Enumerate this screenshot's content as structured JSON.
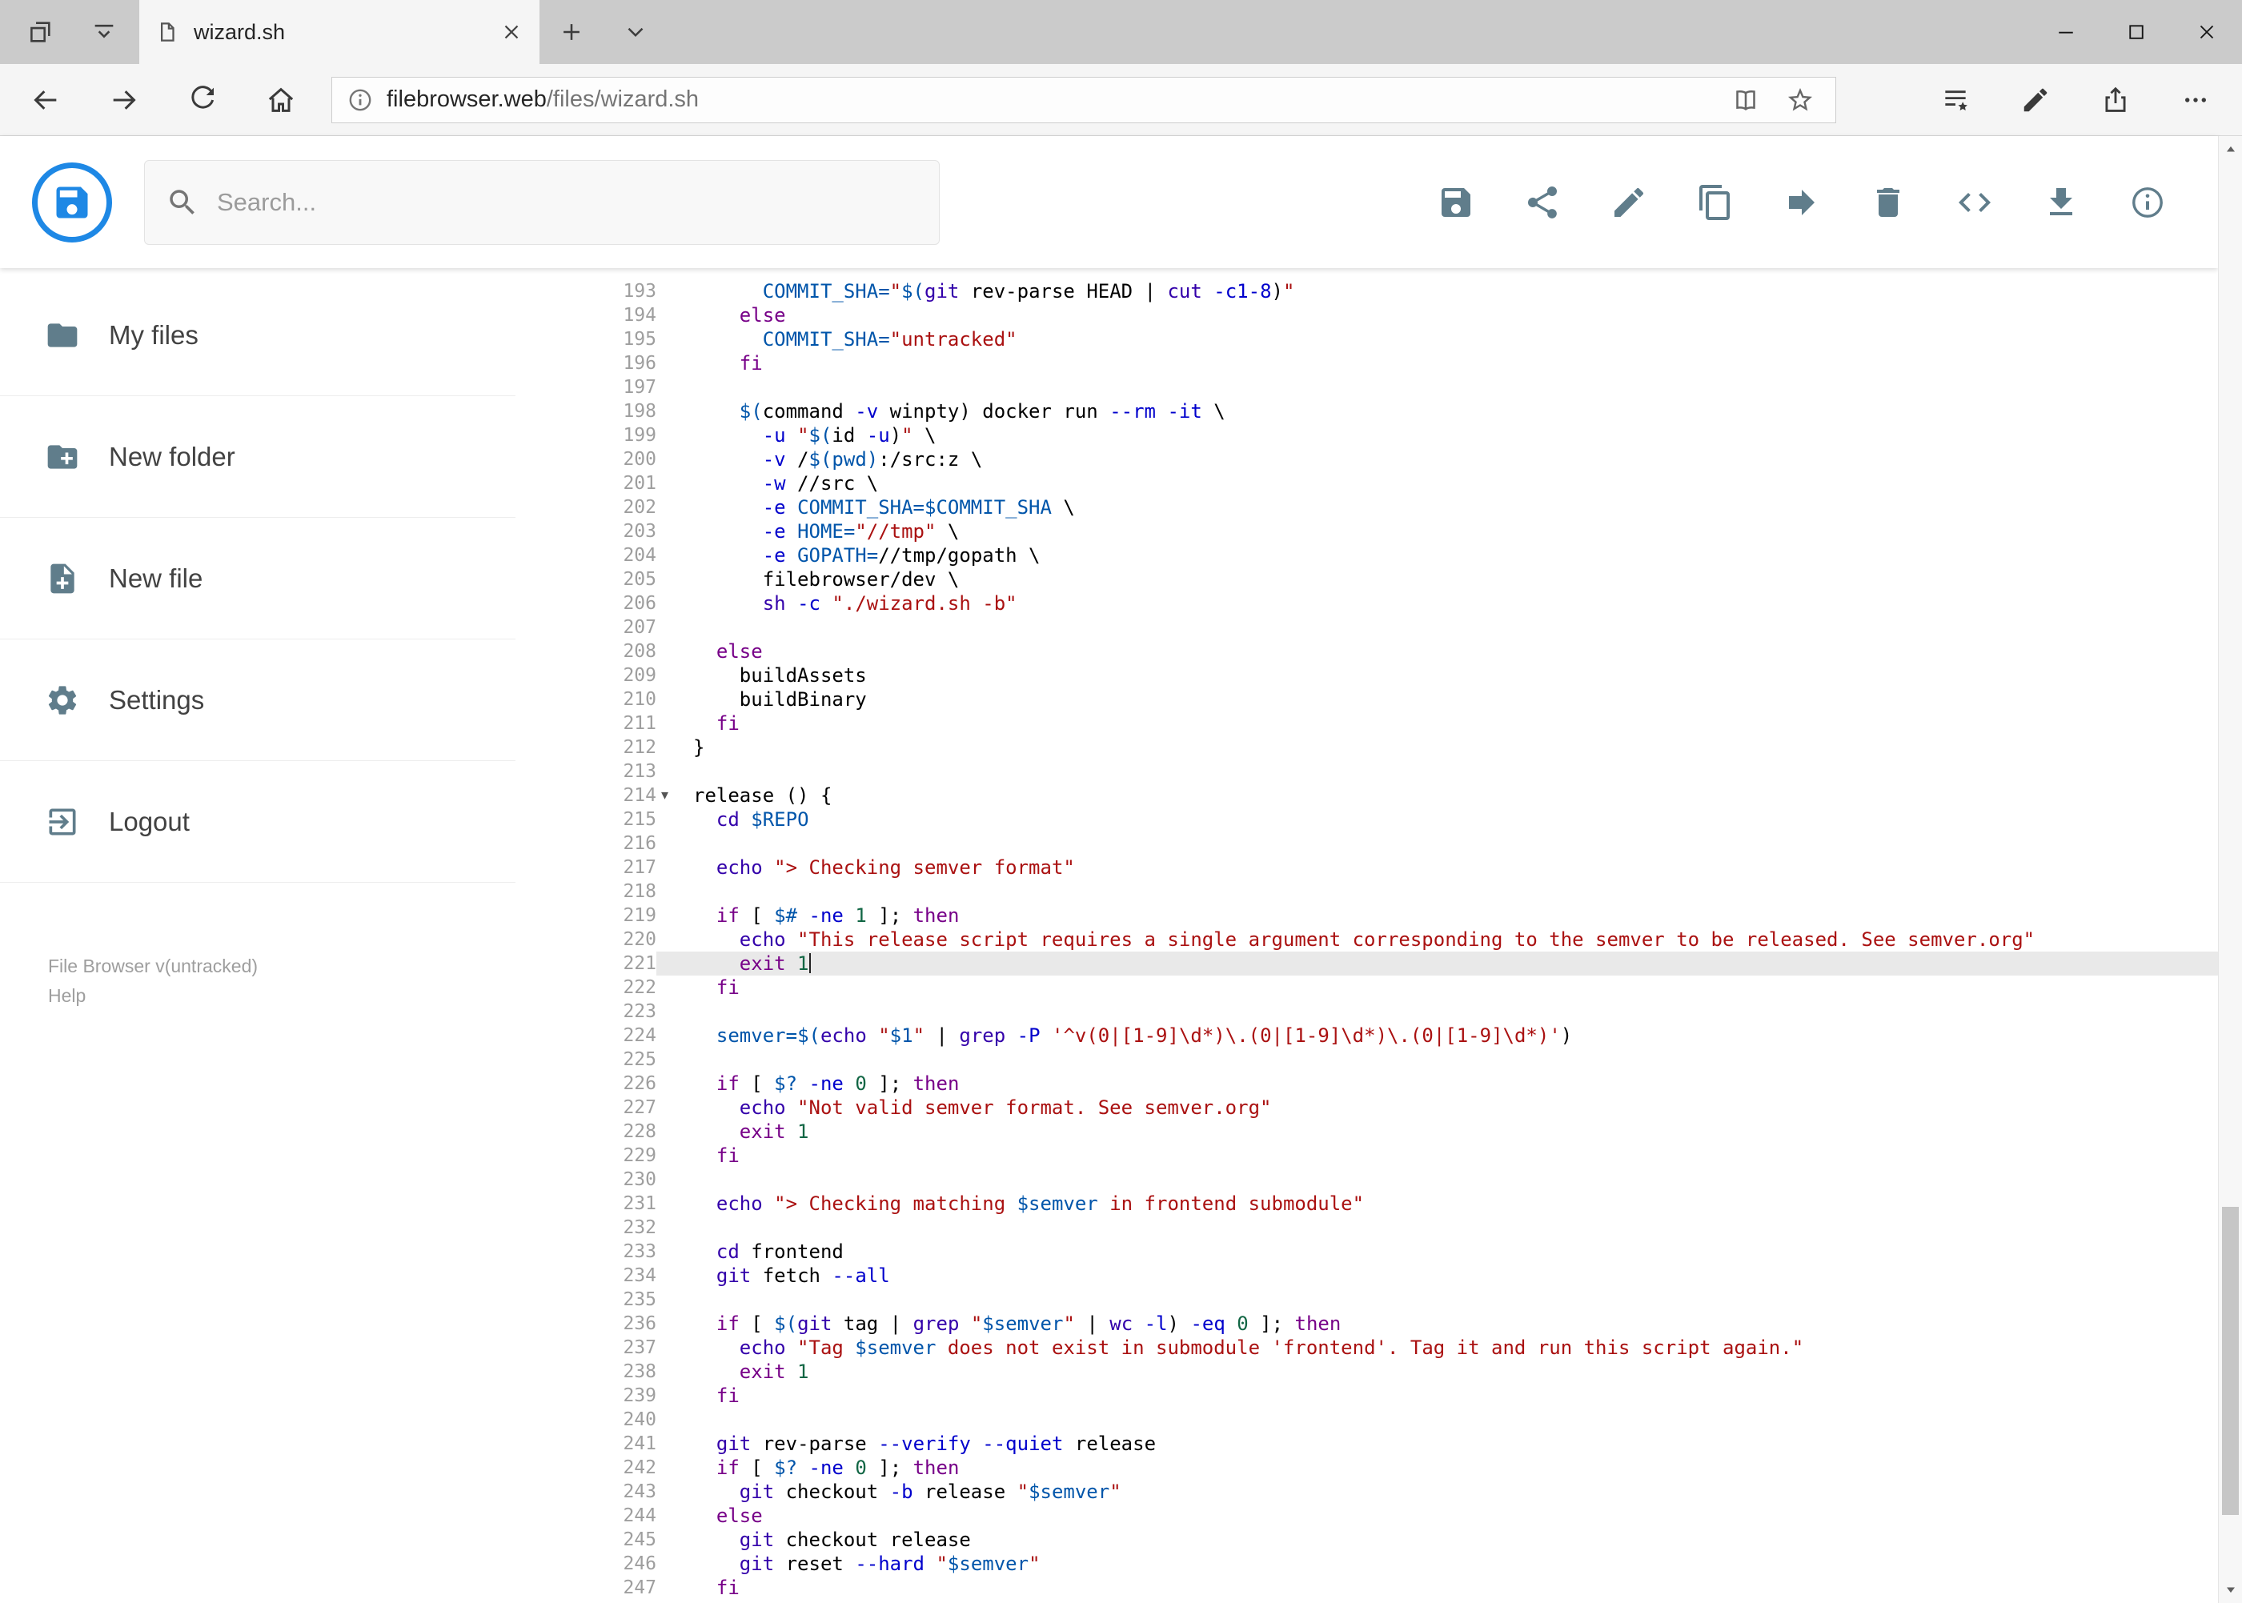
{
  "window": {
    "tab_title": "wizard.sh",
    "controls": [
      "minimize",
      "maximize",
      "close"
    ]
  },
  "address_bar": {
    "url_host": "filebrowser.web",
    "url_path": "/files/wizard.sh"
  },
  "app_header": {
    "search_placeholder": "Search...",
    "actions": [
      {
        "name": "save-button",
        "icon": "save"
      },
      {
        "name": "share-button",
        "icon": "share-nodes"
      },
      {
        "name": "rename-button",
        "icon": "edit"
      },
      {
        "name": "copy-button",
        "icon": "copy"
      },
      {
        "name": "move-button",
        "icon": "move-arrow"
      },
      {
        "name": "delete-button",
        "icon": "trash"
      },
      {
        "name": "code-view-button",
        "icon": "code"
      },
      {
        "name": "download-button",
        "icon": "download"
      },
      {
        "name": "info-button",
        "icon": "info"
      }
    ]
  },
  "sidebar": {
    "items": [
      {
        "name": "sidebar-item-my-files",
        "label": "My files",
        "icon": "folder"
      },
      {
        "name": "sidebar-item-new-folder",
        "label": "New folder",
        "icon": "new-folder"
      },
      {
        "name": "sidebar-item-new-file",
        "label": "New file",
        "icon": "new-file"
      },
      {
        "name": "sidebar-item-settings",
        "label": "Settings",
        "icon": "gear"
      },
      {
        "name": "sidebar-item-logout",
        "label": "Logout",
        "icon": "logout"
      }
    ],
    "footer": {
      "version": "File Browser v(untracked)",
      "help": "Help"
    }
  },
  "editor": {
    "language": "shell",
    "current_line": 221,
    "lines": [
      {
        "n": 193,
        "i": 6,
        "t": [
          [
            "v",
            "COMMIT_SHA="
          ],
          [
            "s",
            "\""
          ],
          [
            "v",
            "$("
          ],
          [
            "b",
            "git"
          ],
          [
            "p",
            " rev-parse HEAD | "
          ],
          [
            "b",
            "cut"
          ],
          [
            "p",
            " "
          ],
          [
            "a",
            "-c1-8"
          ],
          [
            "p",
            ")"
          ],
          [
            "s",
            "\""
          ]
        ]
      },
      {
        "n": 194,
        "i": 4,
        "t": [
          [
            "k",
            "else"
          ]
        ]
      },
      {
        "n": 195,
        "i": 6,
        "t": [
          [
            "v",
            "COMMIT_SHA="
          ],
          [
            "s",
            "\"untracked\""
          ]
        ]
      },
      {
        "n": 196,
        "i": 4,
        "t": [
          [
            "k",
            "fi"
          ]
        ]
      },
      {
        "n": 197,
        "i": 0,
        "t": []
      },
      {
        "n": 198,
        "i": 4,
        "t": [
          [
            "v",
            "$("
          ],
          [
            "p",
            "command "
          ],
          [
            "a",
            "-v"
          ],
          [
            "p",
            " winpty) docker run "
          ],
          [
            "a",
            "--rm"
          ],
          [
            "p",
            " "
          ],
          [
            "a",
            "-it"
          ],
          [
            "p",
            " \\"
          ]
        ]
      },
      {
        "n": 199,
        "i": 6,
        "t": [
          [
            "a",
            "-u"
          ],
          [
            "p",
            " "
          ],
          [
            "s",
            "\""
          ],
          [
            "v",
            "$("
          ],
          [
            "p",
            "id "
          ],
          [
            "a",
            "-u"
          ],
          [
            "p",
            ")"
          ],
          [
            "s",
            "\""
          ],
          [
            "p",
            " \\"
          ]
        ]
      },
      {
        "n": 200,
        "i": 6,
        "t": [
          [
            "a",
            "-v"
          ],
          [
            "p",
            " /"
          ],
          [
            "v",
            "$(pwd)"
          ],
          [
            "p",
            ":/src:z \\"
          ]
        ]
      },
      {
        "n": 201,
        "i": 6,
        "t": [
          [
            "a",
            "-w"
          ],
          [
            "p",
            " //src \\"
          ]
        ]
      },
      {
        "n": 202,
        "i": 6,
        "t": [
          [
            "a",
            "-e"
          ],
          [
            "p",
            " "
          ],
          [
            "v",
            "COMMIT_SHA=$COMMIT_SHA"
          ],
          [
            "p",
            " \\"
          ]
        ]
      },
      {
        "n": 203,
        "i": 6,
        "t": [
          [
            "a",
            "-e"
          ],
          [
            "p",
            " "
          ],
          [
            "v",
            "HOME="
          ],
          [
            "s",
            "\"//tmp\""
          ],
          [
            "p",
            " \\"
          ]
        ]
      },
      {
        "n": 204,
        "i": 6,
        "t": [
          [
            "a",
            "-e"
          ],
          [
            "p",
            " "
          ],
          [
            "v",
            "GOPATH="
          ],
          [
            "p",
            "//tmp/gopath \\"
          ]
        ]
      },
      {
        "n": 205,
        "i": 6,
        "t": [
          [
            "p",
            "filebrowser/dev \\"
          ]
        ]
      },
      {
        "n": 206,
        "i": 6,
        "t": [
          [
            "b",
            "sh"
          ],
          [
            "p",
            " "
          ],
          [
            "a",
            "-c"
          ],
          [
            "p",
            " "
          ],
          [
            "s",
            "\"./wizard.sh -b\""
          ]
        ]
      },
      {
        "n": 207,
        "i": 0,
        "t": []
      },
      {
        "n": 208,
        "i": 2,
        "t": [
          [
            "k",
            "else"
          ]
        ]
      },
      {
        "n": 209,
        "i": 4,
        "t": [
          [
            "p",
            "buildAssets"
          ]
        ]
      },
      {
        "n": 210,
        "i": 4,
        "t": [
          [
            "p",
            "buildBinary"
          ]
        ]
      },
      {
        "n": 211,
        "i": 2,
        "t": [
          [
            "k",
            "fi"
          ]
        ]
      },
      {
        "n": 212,
        "i": 0,
        "t": [
          [
            "p",
            "}"
          ]
        ]
      },
      {
        "n": 213,
        "i": 0,
        "t": []
      },
      {
        "n": 214,
        "i": 0,
        "fold": true,
        "t": [
          [
            "p",
            "release () {"
          ]
        ]
      },
      {
        "n": 215,
        "i": 2,
        "t": [
          [
            "b",
            "cd"
          ],
          [
            "p",
            " "
          ],
          [
            "v",
            "$REPO"
          ]
        ]
      },
      {
        "n": 216,
        "i": 0,
        "t": []
      },
      {
        "n": 217,
        "i": 2,
        "t": [
          [
            "b",
            "echo"
          ],
          [
            "p",
            " "
          ],
          [
            "s",
            "\"> Checking semver format\""
          ]
        ]
      },
      {
        "n": 218,
        "i": 0,
        "t": []
      },
      {
        "n": 219,
        "i": 2,
        "t": [
          [
            "k",
            "if"
          ],
          [
            "p",
            " [ "
          ],
          [
            "v",
            "$#"
          ],
          [
            "p",
            " "
          ],
          [
            "a",
            "-ne"
          ],
          [
            "p",
            " "
          ],
          [
            "n",
            "1"
          ],
          [
            "p",
            " ]; "
          ],
          [
            "k",
            "then"
          ]
        ]
      },
      {
        "n": 220,
        "i": 4,
        "t": [
          [
            "b",
            "echo"
          ],
          [
            "p",
            " "
          ],
          [
            "s",
            "\"This release script requires a single argument corresponding to the semver to be released. See semver.org\""
          ]
        ]
      },
      {
        "n": 221,
        "i": 4,
        "t": [
          [
            "k",
            "exit"
          ],
          [
            "p",
            " "
          ],
          [
            "n",
            "1"
          ]
        ]
      },
      {
        "n": 222,
        "i": 2,
        "t": [
          [
            "k",
            "fi"
          ]
        ]
      },
      {
        "n": 223,
        "i": 0,
        "t": []
      },
      {
        "n": 224,
        "i": 2,
        "t": [
          [
            "v",
            "semver="
          ],
          [
            "v",
            "$("
          ],
          [
            "b",
            "echo"
          ],
          [
            "p",
            " "
          ],
          [
            "s",
            "\""
          ],
          [
            "v",
            "$1"
          ],
          [
            "s",
            "\""
          ],
          [
            "p",
            " | "
          ],
          [
            "b",
            "grep"
          ],
          [
            "p",
            " "
          ],
          [
            "a",
            "-P"
          ],
          [
            "p",
            " "
          ],
          [
            "s",
            "'^v(0|[1-9]\\d*)\\.(0|[1-9]\\d*)\\.(0|[1-9]\\d*)'"
          ],
          [
            "p",
            ")"
          ]
        ]
      },
      {
        "n": 225,
        "i": 0,
        "t": []
      },
      {
        "n": 226,
        "i": 2,
        "t": [
          [
            "k",
            "if"
          ],
          [
            "p",
            " [ "
          ],
          [
            "v",
            "$?"
          ],
          [
            "p",
            " "
          ],
          [
            "a",
            "-ne"
          ],
          [
            "p",
            " "
          ],
          [
            "n",
            "0"
          ],
          [
            "p",
            " ]; "
          ],
          [
            "k",
            "then"
          ]
        ]
      },
      {
        "n": 227,
        "i": 4,
        "t": [
          [
            "b",
            "echo"
          ],
          [
            "p",
            " "
          ],
          [
            "s",
            "\"Not valid semver format. See semver.org\""
          ]
        ]
      },
      {
        "n": 228,
        "i": 4,
        "t": [
          [
            "k",
            "exit"
          ],
          [
            "p",
            " "
          ],
          [
            "n",
            "1"
          ]
        ]
      },
      {
        "n": 229,
        "i": 2,
        "t": [
          [
            "k",
            "fi"
          ]
        ]
      },
      {
        "n": 230,
        "i": 0,
        "t": []
      },
      {
        "n": 231,
        "i": 2,
        "t": [
          [
            "b",
            "echo"
          ],
          [
            "p",
            " "
          ],
          [
            "s",
            "\"> Checking matching "
          ],
          [
            "v",
            "$semver"
          ],
          [
            "s",
            " in frontend submodule\""
          ]
        ]
      },
      {
        "n": 232,
        "i": 0,
        "t": []
      },
      {
        "n": 233,
        "i": 2,
        "t": [
          [
            "b",
            "cd"
          ],
          [
            "p",
            " frontend"
          ]
        ]
      },
      {
        "n": 234,
        "i": 2,
        "t": [
          [
            "b",
            "git"
          ],
          [
            "p",
            " fetch "
          ],
          [
            "a",
            "--all"
          ]
        ]
      },
      {
        "n": 235,
        "i": 0,
        "t": []
      },
      {
        "n": 236,
        "i": 2,
        "t": [
          [
            "k",
            "if"
          ],
          [
            "p",
            " [ "
          ],
          [
            "v",
            "$("
          ],
          [
            "b",
            "git"
          ],
          [
            "p",
            " tag | "
          ],
          [
            "b",
            "grep"
          ],
          [
            "p",
            " "
          ],
          [
            "s",
            "\""
          ],
          [
            "v",
            "$semver"
          ],
          [
            "s",
            "\""
          ],
          [
            "p",
            " | "
          ],
          [
            "b",
            "wc"
          ],
          [
            "p",
            " "
          ],
          [
            "a",
            "-l"
          ],
          [
            "p",
            ") "
          ],
          [
            "a",
            "-eq"
          ],
          [
            "p",
            " "
          ],
          [
            "n",
            "0"
          ],
          [
            "p",
            " ]; "
          ],
          [
            "k",
            "then"
          ]
        ]
      },
      {
        "n": 237,
        "i": 4,
        "t": [
          [
            "b",
            "echo"
          ],
          [
            "p",
            " "
          ],
          [
            "s",
            "\"Tag "
          ],
          [
            "v",
            "$semver"
          ],
          [
            "s",
            " does not exist in submodule 'frontend'. Tag it and run this script again.\""
          ]
        ]
      },
      {
        "n": 238,
        "i": 4,
        "t": [
          [
            "k",
            "exit"
          ],
          [
            "p",
            " "
          ],
          [
            "n",
            "1"
          ]
        ]
      },
      {
        "n": 239,
        "i": 2,
        "t": [
          [
            "k",
            "fi"
          ]
        ]
      },
      {
        "n": 240,
        "i": 0,
        "t": []
      },
      {
        "n": 241,
        "i": 2,
        "t": [
          [
            "b",
            "git"
          ],
          [
            "p",
            " rev-parse "
          ],
          [
            "a",
            "--verify"
          ],
          [
            "p",
            " "
          ],
          [
            "a",
            "--quiet"
          ],
          [
            "p",
            " release"
          ]
        ]
      },
      {
        "n": 242,
        "i": 2,
        "t": [
          [
            "k",
            "if"
          ],
          [
            "p",
            " [ "
          ],
          [
            "v",
            "$?"
          ],
          [
            "p",
            " "
          ],
          [
            "a",
            "-ne"
          ],
          [
            "p",
            " "
          ],
          [
            "n",
            "0"
          ],
          [
            "p",
            " ]; "
          ],
          [
            "k",
            "then"
          ]
        ]
      },
      {
        "n": 243,
        "i": 4,
        "t": [
          [
            "b",
            "git"
          ],
          [
            "p",
            " checkout "
          ],
          [
            "a",
            "-b"
          ],
          [
            "p",
            " release "
          ],
          [
            "s",
            "\""
          ],
          [
            "v",
            "$semver"
          ],
          [
            "s",
            "\""
          ]
        ]
      },
      {
        "n": 244,
        "i": 2,
        "t": [
          [
            "k",
            "else"
          ]
        ]
      },
      {
        "n": 245,
        "i": 4,
        "t": [
          [
            "b",
            "git"
          ],
          [
            "p",
            " checkout release"
          ]
        ]
      },
      {
        "n": 246,
        "i": 4,
        "t": [
          [
            "b",
            "git"
          ],
          [
            "p",
            " reset "
          ],
          [
            "a",
            "--hard"
          ],
          [
            "p",
            " "
          ],
          [
            "s",
            "\""
          ],
          [
            "v",
            "$semver"
          ],
          [
            "s",
            "\""
          ]
        ]
      },
      {
        "n": 247,
        "i": 2,
        "t": [
          [
            "k",
            "fi"
          ]
        ]
      }
    ]
  },
  "colors": {
    "accent_blue": "#1e88e5",
    "app_icon_gray_blue": "#607d8b",
    "tabbar_bg": "#cbcbcb",
    "chrome_bg": "#f5f5f5",
    "active_line_bg": "#e9e9e9",
    "syntax_legend": {
      "p": "plain",
      "k": "keyword",
      "b": "builtin",
      "v": "variable",
      "a": "option",
      "n": "number",
      "s": "string"
    },
    "syntax": {
      "p": "#000000",
      "k": "#770088",
      "b": "#3300aa",
      "v": "#0055aa",
      "a": "#0000cc",
      "n": "#116644",
      "s": "#aa1111"
    }
  }
}
